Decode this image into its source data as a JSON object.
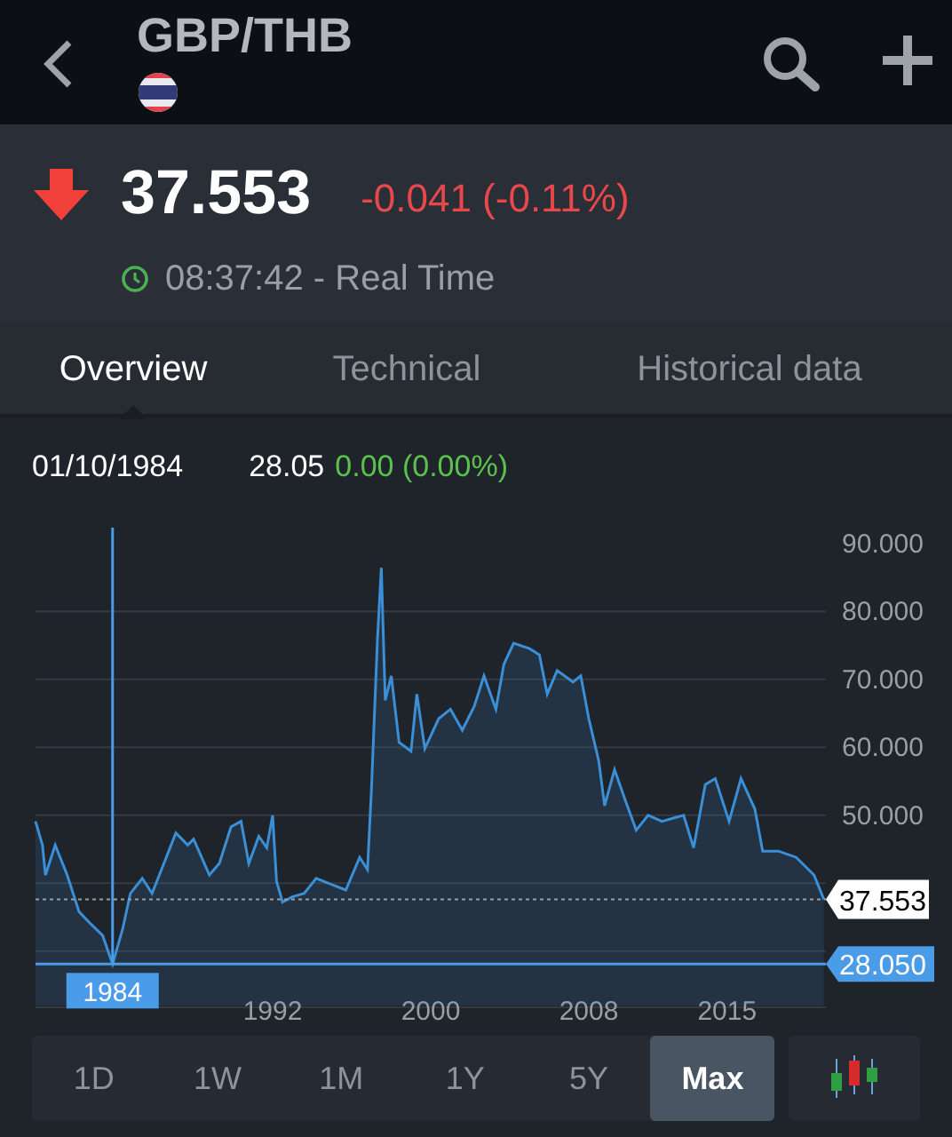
{
  "header": {
    "title": "GBP/THB"
  },
  "quote": {
    "falling": true,
    "price": "37.553",
    "change": "-0.041 (-0.11%)",
    "time": "08:37:42 - Real Time"
  },
  "tabs": [
    {
      "label": "Overview",
      "selected": true
    },
    {
      "label": "Technical",
      "selected": false
    },
    {
      "label": "Historical data",
      "selected": false
    }
  ],
  "crosshair_info": {
    "date": "01/10/1984",
    "value": "28.05",
    "change": "0.00 (0.00%)"
  },
  "chart": {
    "last_price_label": "37.553",
    "crosshair_value_label": "28.050",
    "crosshair_date_label": "1984",
    "chart_data": {
      "type": "area",
      "x": [
        1980.0,
        1980.35,
        1980.5,
        1981.0,
        1981.6,
        1982.2,
        1982.8,
        1983.4,
        1983.9,
        1984.4,
        1984.8,
        1985.4,
        1985.9,
        1986.5,
        1987.1,
        1987.7,
        1988.0,
        1988.8,
        1989.3,
        1989.9,
        1990.4,
        1990.8,
        1991.3,
        1991.7,
        1992.0,
        1992.2,
        1992.5,
        1993.0,
        1993.6,
        1994.2,
        1995.0,
        1995.7,
        1996.4,
        1996.8,
        1997.0,
        1997.3,
        1997.5,
        1997.7,
        1998.0,
        1998.4,
        1999.0,
        1999.3,
        1999.7,
        2000.4,
        2001.0,
        2001.6,
        2002.2,
        2002.7,
        2003.3,
        2003.7,
        2004.2,
        2005.0,
        2005.5,
        2005.9,
        2006.4,
        2007.2,
        2007.6,
        2008.0,
        2008.5,
        2008.8,
        2009.3,
        2009.9,
        2010.4,
        2011.0,
        2011.7,
        2012.8,
        2013.3,
        2013.9,
        2014.4,
        2015.1,
        2015.7,
        2016.4,
        2016.8,
        2017.6,
        2018.5,
        2019.4,
        2019.9
      ],
      "grid": true,
      "ref_lines": [
        {
          "axis": "x",
          "value": 1983.9,
          "color": "#4a9be8"
        },
        {
          "axis": "y",
          "value": 37.6,
          "color": "#9aa0a6"
        },
        {
          "axis": "y",
          "value": 28.1,
          "color": "#4a9be8"
        }
      ],
      "series": [
        {
          "color": "#3b8fd6",
          "values": [
            49.1,
            45.6,
            41.2,
            45.6,
            41.2,
            35.8,
            34.0,
            32.3,
            28.1,
            33.2,
            38.5,
            40.7,
            38.5,
            42.9,
            47.4,
            45.6,
            46.5,
            41.2,
            42.9,
            48.3,
            49.1,
            42.9,
            46.9,
            45.2,
            50.0,
            40.3,
            37.2,
            38.0,
            38.5,
            40.7,
            39.8,
            39.0,
            43.8,
            42.0,
            53.6,
            75.8,
            86.4,
            66.9,
            70.5,
            60.7,
            59.4,
            67.8,
            59.8,
            64.2,
            65.6,
            62.5,
            66.0,
            70.5,
            65.6,
            72.2,
            75.3,
            74.5,
            73.6,
            67.8,
            71.3,
            69.6,
            70.5,
            64.2,
            58.0,
            51.4,
            56.7,
            51.8,
            47.8,
            50.0,
            49.1,
            50.0,
            45.2,
            54.5,
            55.4,
            49.1,
            55.4,
            50.9,
            44.7,
            44.7,
            43.8,
            41.2,
            37.6
          ]
        }
      ],
      "xlim": [
        1980,
        2020
      ],
      "ylim": [
        22,
        92.3
      ],
      "xticks": [
        1992,
        2000,
        2008,
        2015
      ],
      "yticks": [
        {
          "value": 50,
          "label": "50.000"
        },
        {
          "value": 60,
          "label": "60.000"
        },
        {
          "value": 70,
          "label": "70.000"
        },
        {
          "value": 80,
          "label": "80.000"
        },
        {
          "value": 90,
          "label": "90.000"
        }
      ]
    }
  },
  "ranges": [
    {
      "label": "1D",
      "selected": false
    },
    {
      "label": "1W",
      "selected": false
    },
    {
      "label": "1M",
      "selected": false
    },
    {
      "label": "1Y",
      "selected": false
    },
    {
      "label": "5Y",
      "selected": false
    },
    {
      "label": "Max",
      "selected": true
    }
  ]
}
